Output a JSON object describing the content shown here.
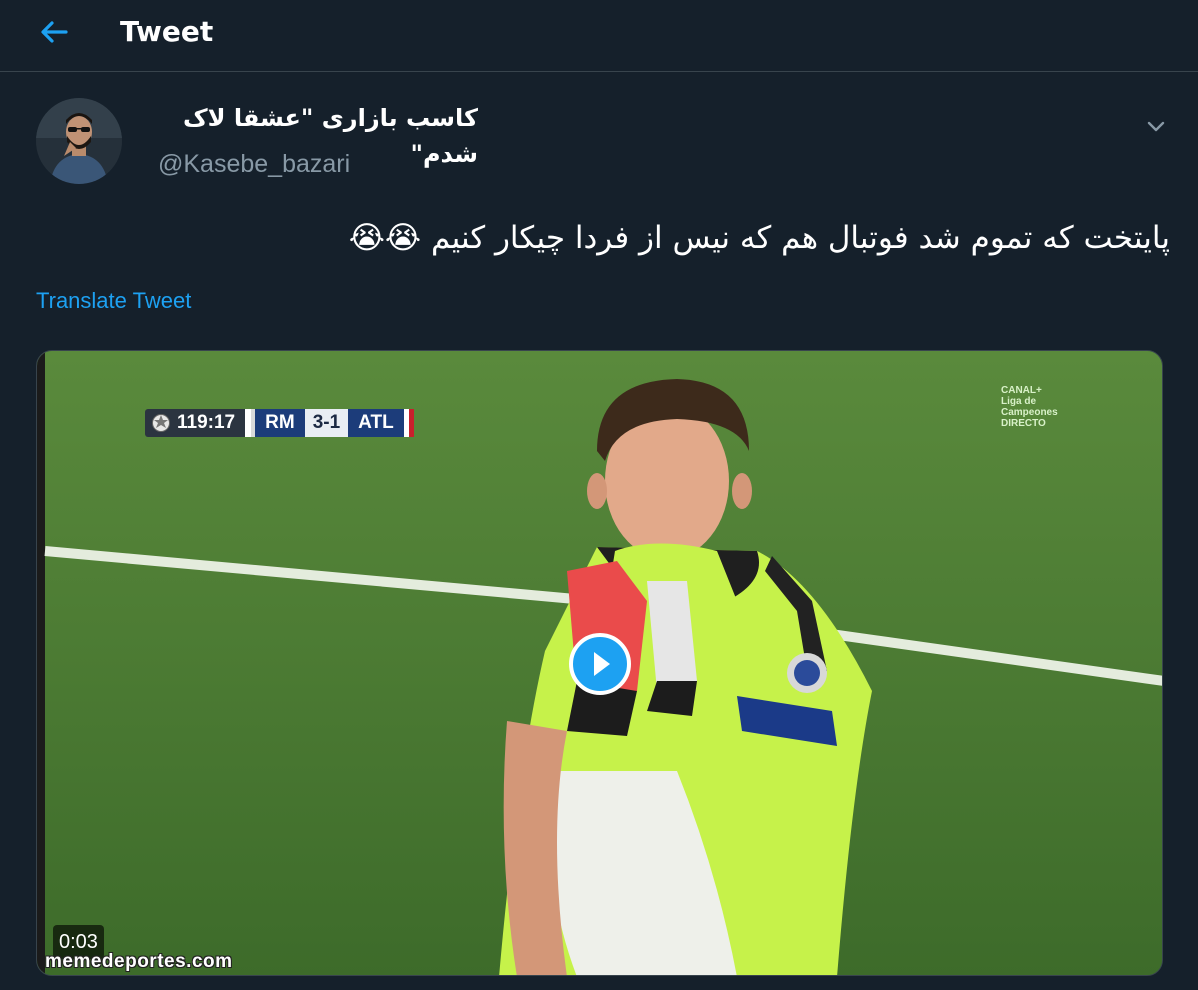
{
  "header": {
    "title": "Tweet",
    "back_icon": "back-arrow-icon",
    "accent_color": "#1da1f2"
  },
  "tweet": {
    "display_name": "کاسب بازاری \"عشقا لاک شدم\"",
    "handle": "@Kasebe_bazari",
    "text": "پایتخت که تموم شد فوتبال هم که نیس از فردا چیکار کنیم 😭😭",
    "translate_label": "Translate Tweet",
    "menu_icon": "chevron-down-icon"
  },
  "media": {
    "type": "video",
    "duration": "0:03",
    "watermark": "memedeportes.com",
    "scorebug": {
      "time": "119:17",
      "home": "RM",
      "score": "3-1",
      "away": "ATL"
    },
    "channel_logo": [
      "CANAL+",
      "Liga de",
      "Campeones",
      "DIRECTO"
    ]
  },
  "colors": {
    "background": "#15202b",
    "divider": "#38444d",
    "secondary_text": "#8899a6"
  }
}
